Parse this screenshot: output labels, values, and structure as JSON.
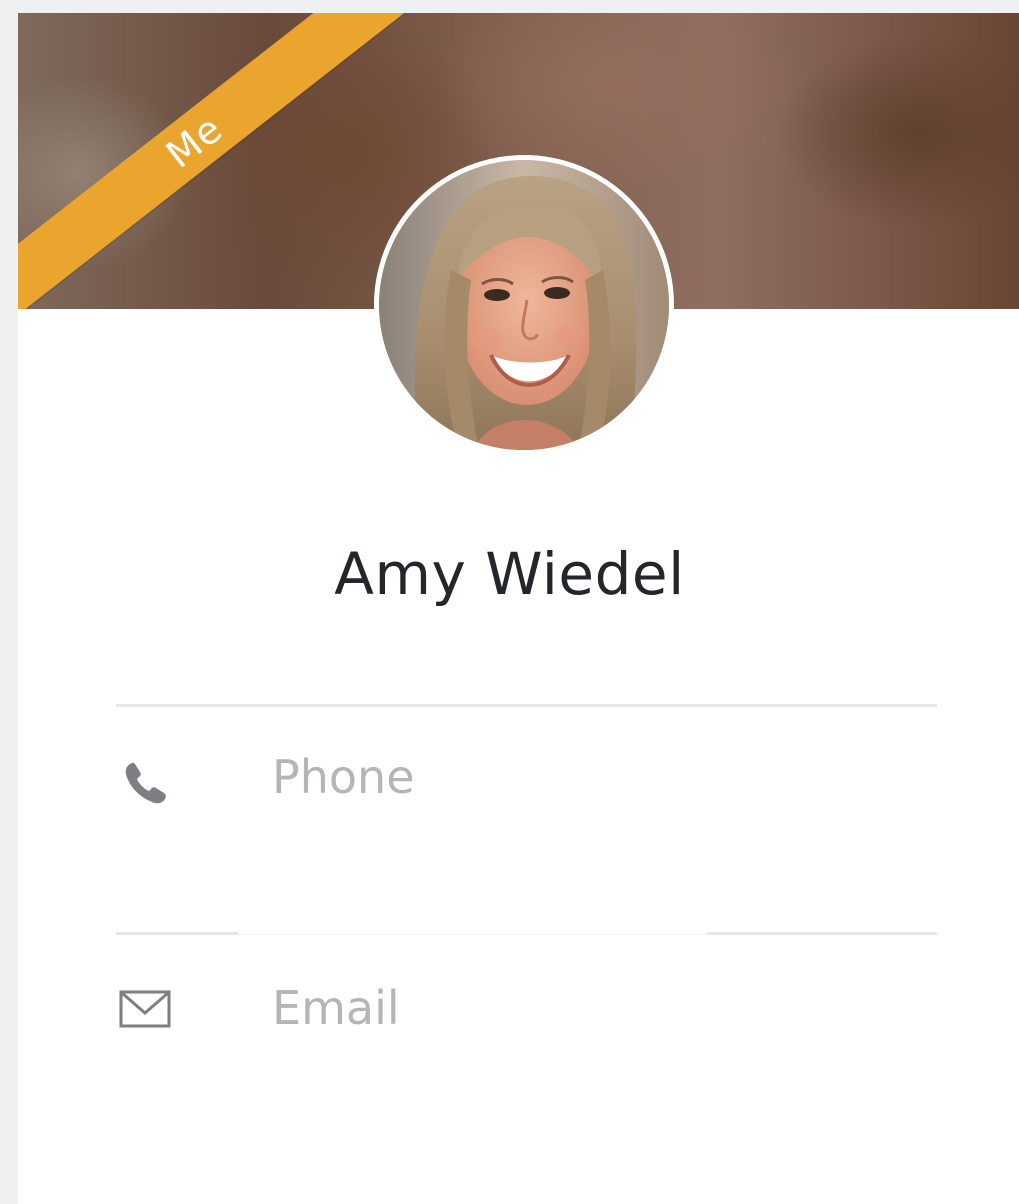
{
  "profile": {
    "badge": "Me",
    "name": "Amy Wiedel"
  },
  "contact": {
    "phone_label": "Phone",
    "email_label": "Email"
  },
  "icons": {
    "phone": "phone-icon",
    "email": "envelope-icon"
  },
  "colors": {
    "badge": "#e9a52d",
    "name_text": "#23272b",
    "placeholder_text": "#b3b5b8",
    "divider": "#e5e6e8"
  }
}
